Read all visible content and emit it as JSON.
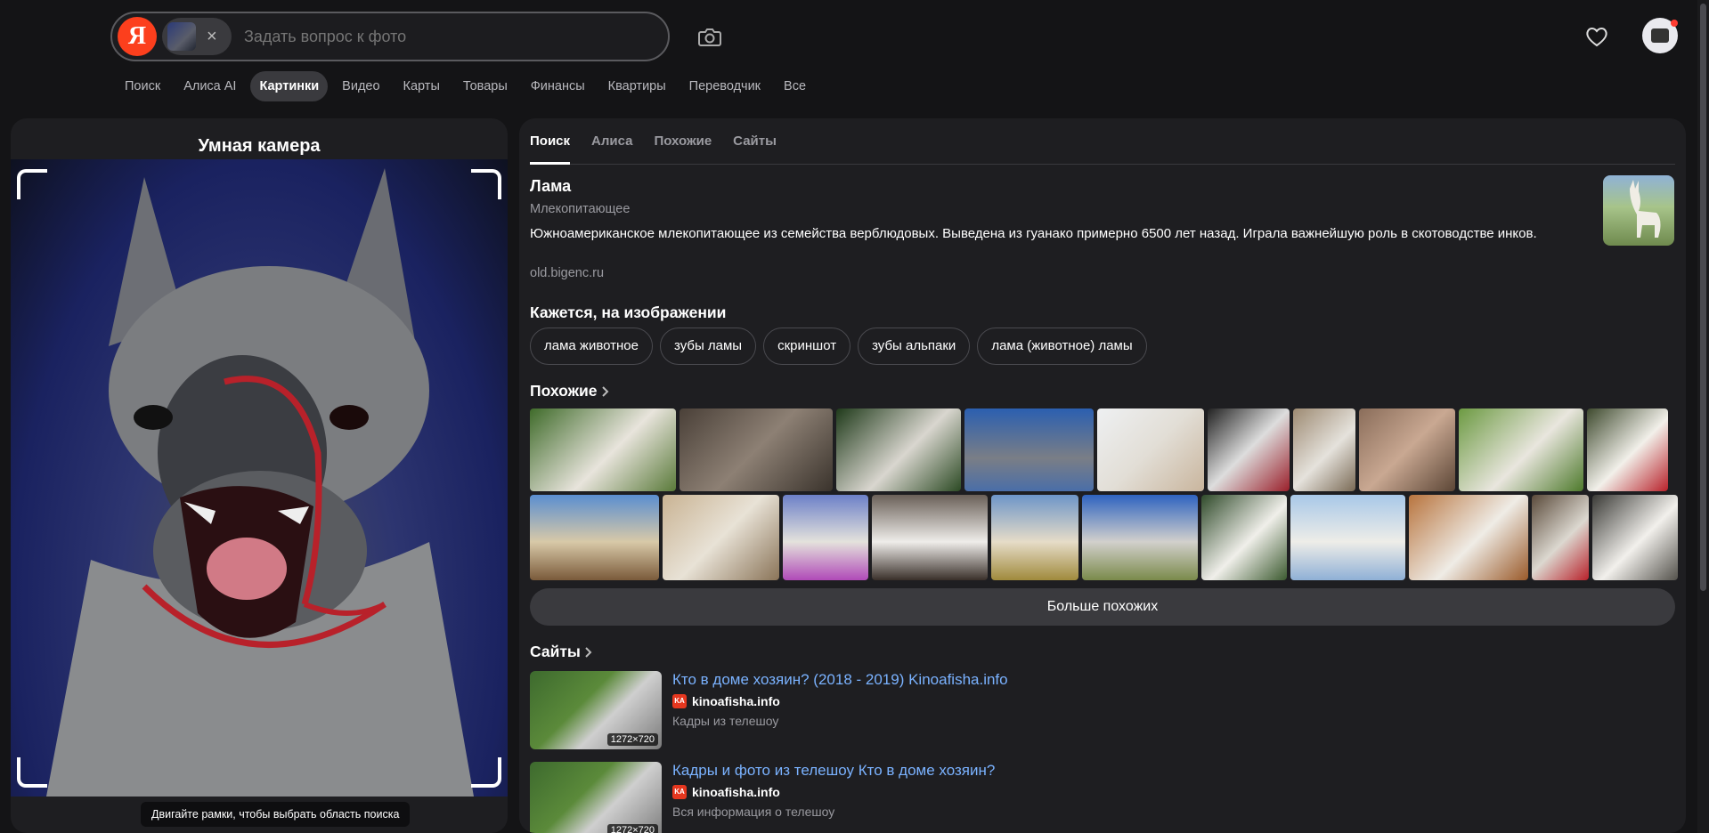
{
  "search": {
    "logo": "Я",
    "placeholder": "Задать вопрос к фото",
    "clear": "×"
  },
  "nav": [
    "Поиск",
    "Алиса AI",
    "Картинки",
    "Видео",
    "Карты",
    "Товары",
    "Финансы",
    "Квартиры",
    "Переводчик",
    "Все"
  ],
  "nav_active": "Картинки",
  "camera": {
    "title": "Умная камера",
    "hint": "Двигайте рамки, чтобы выбрать область поиска"
  },
  "tabs": [
    "Поиск",
    "Алиса",
    "Похожие",
    "Сайты"
  ],
  "tabs_active": "Поиск",
  "entity": {
    "title": "Лама",
    "subtitle": "Млекопитающее",
    "description": "Южноамериканское млекопитающее из семейства верблюдовых. Выведена из гуанако примерно 6500 лет назад. Играла важнейшую роль в скотоводстве инков.",
    "source": "old.bigenc.ru"
  },
  "seems": {
    "heading": "Кажется, на изображении",
    "chips": [
      "лама животное",
      "зубы ламы",
      "скриншот",
      "зубы альпаки",
      "лама (животное) ламы"
    ]
  },
  "similar": {
    "heading": "Похожие",
    "more_button": "Больше похожих"
  },
  "sites": {
    "heading": "Сайты",
    "items": [
      {
        "title": "Кто в доме хозяин? (2018 - 2019) Kinoafisha.info",
        "domain": "kinoafisha.info",
        "favicon": "KA",
        "snippet": "Кадры из телешоу",
        "resolution": "1272×720"
      },
      {
        "title": "Кадры и фото из телешоу Кто в доме хозяин?",
        "domain": "kinoafisha.info",
        "favicon": "KA",
        "snippet": "Вся информация о телешоу",
        "resolution": "1272×720"
      }
    ]
  },
  "colors": {
    "background": "#141416",
    "panel": "#1e1e21",
    "yandex_red": "#fc3f1d",
    "link": "#7ab2ff"
  },
  "icons": [
    "camera-icon",
    "heart-icon",
    "chevron-right-icon"
  ]
}
